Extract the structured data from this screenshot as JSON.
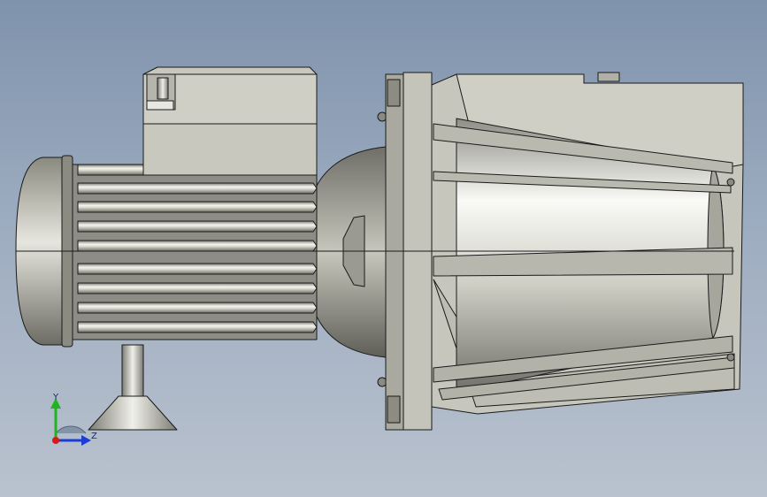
{
  "viewport": {
    "background_top": "#7f93ac",
    "background_bottom": "#b9c2ce"
  },
  "model": {
    "body_color": "#c9c9bf",
    "edge_color": "#1a1a1a"
  },
  "triad": {
    "y_label": "Y",
    "z_label": "Z",
    "y_color": "#1fb51f",
    "z_color": "#1a3dd6",
    "x_color": "#d61a1a"
  }
}
